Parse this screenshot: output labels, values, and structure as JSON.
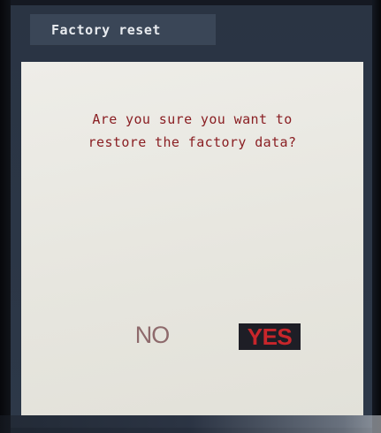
{
  "dialog": {
    "title": "Factory reset",
    "message_line1": "Are you sure you want to",
    "message_line2": "restore the factory data?",
    "no_label": "NO",
    "yes_label": "YES"
  },
  "colors": {
    "screen_bg": "#2b3646",
    "title_bar_bg": "#3a4657",
    "dialog_bg": "#eeede8",
    "message_text": "#8a1f23",
    "no_text": "#8e6a6c",
    "yes_bg": "#1e1e26",
    "yes_text": "#c8262b"
  }
}
